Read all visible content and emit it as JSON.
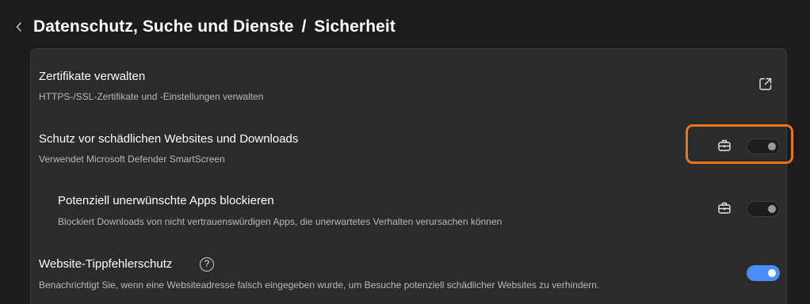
{
  "header": {
    "breadcrumb_parent": "Datenschutz, Suche und Dienste",
    "separator": "/",
    "current_page": "Sicherheit"
  },
  "settings": [
    {
      "id": "certificates",
      "title": "Zertifikate verwalten",
      "subtitle": "HTTPS-/SSL-Zertifikate und -Einstellungen verwalten",
      "action_icon": "external-link-icon"
    },
    {
      "id": "smartscreen",
      "title": "Schutz vor schädlichen Websites und Downloads",
      "subtitle": "Verwendet Microsoft Defender SmartScreen",
      "managed_icon": "briefcase-icon",
      "toggle_on": false,
      "highlighted": true
    },
    {
      "id": "pua",
      "title": "Potenziell unerwünschte Apps blockieren",
      "subtitle": "Blockiert Downloads von nicht vertrauenswürdigen Apps, die unerwartetes Verhalten verursachen können",
      "managed_icon": "briefcase-icon",
      "toggle_on": false
    },
    {
      "id": "typosquatting",
      "title": "Website-Tippfehlerschutz",
      "subtitle": "Benachrichtigt Sie, wenn eine Websiteadresse falsch eingegeben wurde, um Besuche potenziell schädlicher Websites zu verhindern.",
      "help_icon": "question-mark-icon",
      "help_glyph": "?",
      "toggle_on": true
    }
  ],
  "colors": {
    "background": "#1c1c1c",
    "card": "#2b2b2b",
    "accent": "#4c8cf5",
    "highlight": "#f07417"
  }
}
